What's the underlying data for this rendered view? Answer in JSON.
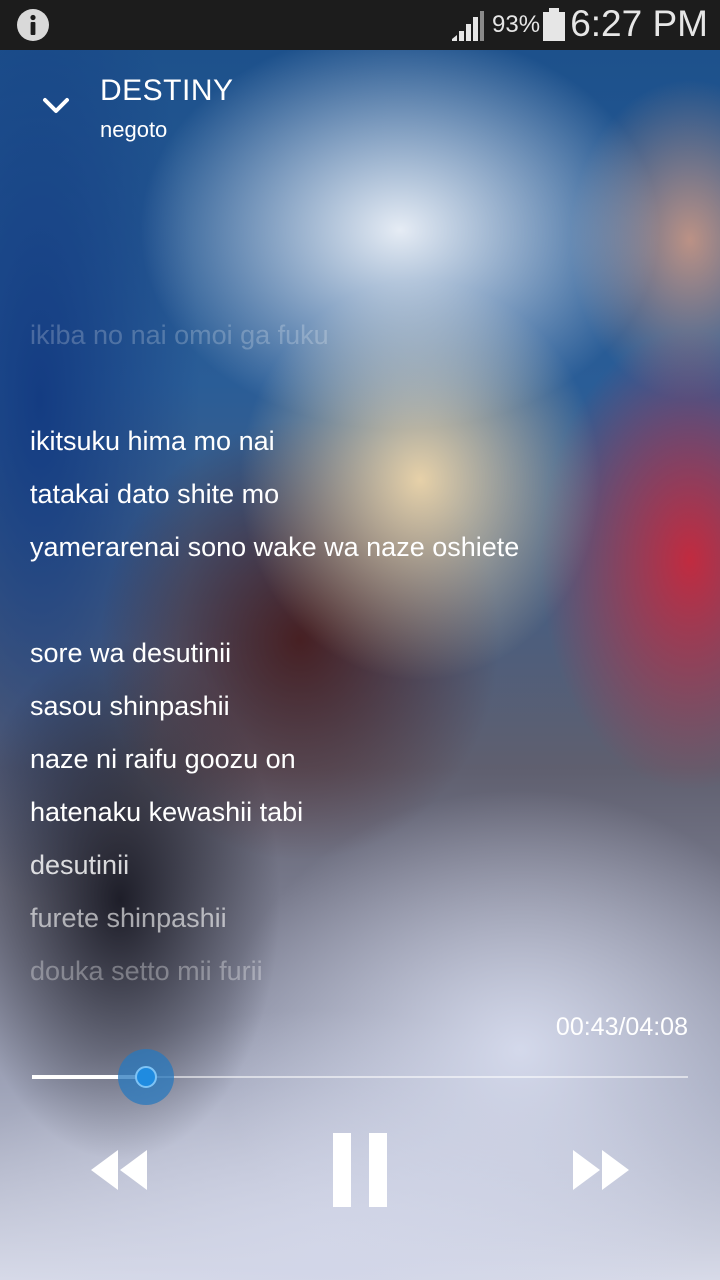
{
  "status_bar": {
    "battery_percent": "93%",
    "time": "6:27 PM",
    "icons": [
      "info-icon",
      "signal-icon",
      "battery-icon"
    ]
  },
  "header": {
    "title": "DESTINY",
    "artist": "negoto",
    "collapse_icon": "chevron-down-icon"
  },
  "lyrics": {
    "lines": [
      "ikiba no nai omoi ga fuku",
      "",
      "ikitsuku hima mo nai",
      "tatakai dato shite mo",
      "yamerarenai sono wake wa naze oshiete",
      "",
      "sore wa desutinii",
      "sasou shinpashii",
      "naze ni raifu goozu on",
      "hatenaku kewashii tabi",
      "desutinii",
      "furete shinpashii",
      "douka setto mii furii"
    ]
  },
  "playback": {
    "time_text": "00:43/04:08",
    "progress_fraction": 0.174,
    "controls": [
      "rewind-icon",
      "pause-icon",
      "fast-forward-icon"
    ]
  },
  "colors": {
    "accent": "#1f8be0",
    "status_bar_bg": "#1c1c1c"
  }
}
